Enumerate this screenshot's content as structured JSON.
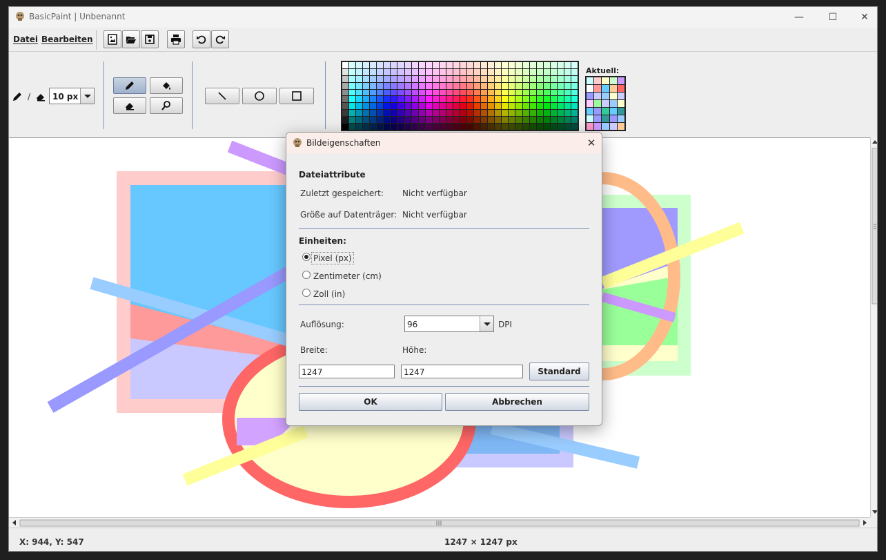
{
  "window": {
    "title": "BasicPaint | Unbenannt",
    "controls": {
      "minimize": "—",
      "maximize": "☐",
      "close": "✕"
    }
  },
  "menu": {
    "file": "Datei",
    "edit": "Bearbeiten"
  },
  "toolbar": {
    "pen_separator": "/",
    "brush_size": "10 px"
  },
  "palette": {
    "current_label": "Aktuell:"
  },
  "status": {
    "coords": "X: 944, Y: 547",
    "size": "1247 × 1247 px"
  },
  "dialog": {
    "title": "Bildeigenschaften",
    "close": "✕",
    "file_attributes_heading": "Dateiattribute",
    "last_saved_label": "Zuletzt gespeichert:",
    "last_saved_value": "Nicht verfügbar",
    "disk_size_label": "Größe auf Datenträger:",
    "disk_size_value": "Nicht verfügbar",
    "units_heading": "Einheiten:",
    "unit_options": [
      "Pixel (px)",
      "Zentimeter (cm)",
      "Zoll (in)"
    ],
    "selected_unit": "Pixel (px)",
    "resolution_label": "Auflösung:",
    "resolution_value": "96",
    "resolution_unit": "DPI",
    "width_label": "Breite:",
    "height_label": "Höhe:",
    "width_value": "1247",
    "height_value": "1247",
    "standard_button": "Standard",
    "ok_button": "OK",
    "cancel_button": "Abbrechen"
  }
}
